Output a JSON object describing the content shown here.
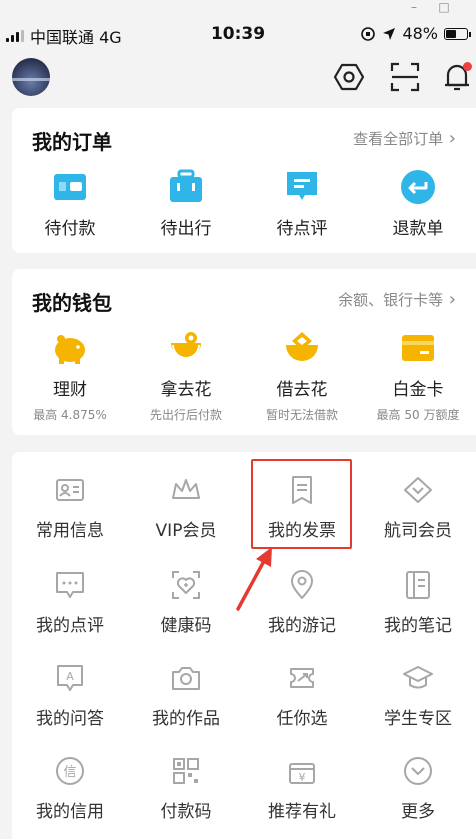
{
  "status_bar": {
    "carrier": "中国联通",
    "network": "4G",
    "time": "10:39",
    "battery": "48%"
  },
  "window_controls": {
    "minimize": "–",
    "maximize": "□"
  },
  "orders": {
    "title": "我的订单",
    "more": "查看全部订单",
    "items": [
      {
        "label": "待付款",
        "icon": "wallet-icon"
      },
      {
        "label": "待出行",
        "icon": "suitcase-icon"
      },
      {
        "label": "待点评",
        "icon": "comment-icon"
      },
      {
        "label": "退款单",
        "icon": "refund-icon"
      }
    ]
  },
  "wallet": {
    "title": "我的钱包",
    "more": "余额、银行卡等",
    "items": [
      {
        "label": "理财",
        "sub": "最高 4.875%",
        "icon": "piggy-bank-icon"
      },
      {
        "label": "拿去花",
        "sub": "先出行后付款",
        "icon": "spend-icon"
      },
      {
        "label": "借去花",
        "sub": "暂时无法借款",
        "icon": "borrow-icon"
      },
      {
        "label": "白金卡",
        "sub": "最高 50 万额度",
        "icon": "platinum-card-icon"
      }
    ]
  },
  "tools": {
    "rows": [
      [
        {
          "label": "常用信息",
          "icon": "id-card-icon"
        },
        {
          "label": "VIP会员",
          "icon": "crown-icon"
        },
        {
          "label": "我的发票",
          "icon": "invoice-icon"
        },
        {
          "label": "航司会员",
          "icon": "diamond-icon"
        }
      ],
      [
        {
          "label": "我的点评",
          "icon": "chat-bubble-icon"
        },
        {
          "label": "健康码",
          "icon": "health-code-icon"
        },
        {
          "label": "我的游记",
          "icon": "location-pin-icon"
        },
        {
          "label": "我的笔记",
          "icon": "notebook-icon"
        }
      ],
      [
        {
          "label": "我的问答",
          "icon": "qa-icon"
        },
        {
          "label": "我的作品",
          "icon": "camera-icon"
        },
        {
          "label": "任你选",
          "icon": "ticket-plane-icon"
        },
        {
          "label": "学生专区",
          "icon": "graduation-cap-icon"
        }
      ],
      [
        {
          "label": "我的信用",
          "icon": "credit-icon"
        },
        {
          "label": "付款码",
          "icon": "qr-code-icon"
        },
        {
          "label": "推荐有礼",
          "icon": "gift-yen-icon"
        },
        {
          "label": "更多",
          "icon": "more-chevron-icon"
        }
      ]
    ]
  },
  "colors": {
    "order_icon": "#2fb5e8",
    "wallet_icon": "#f5b400",
    "tool_icon": "#a7a7a7",
    "highlight": "#e53a2f"
  }
}
